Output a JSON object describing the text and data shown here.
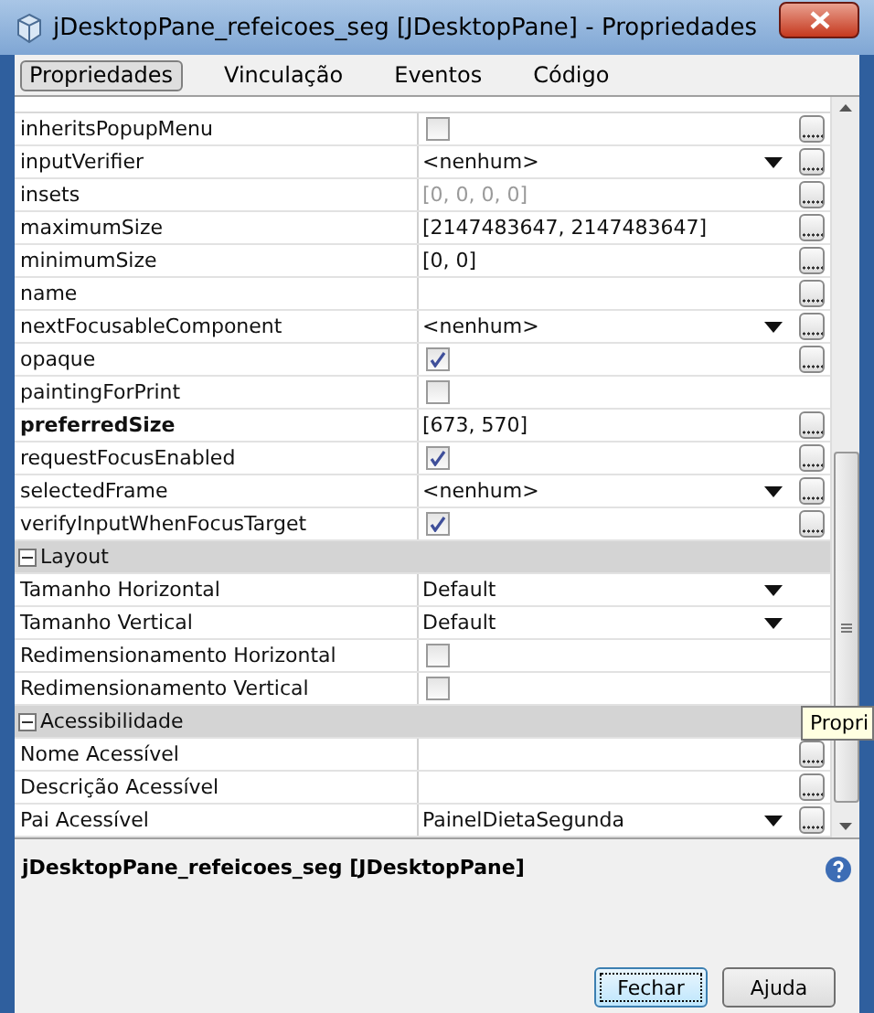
{
  "window": {
    "title": "jDesktopPane_refeicoes_seg [JDesktopPane] - Propriedades"
  },
  "tabs": [
    {
      "label": "Propriedades",
      "selected": true
    },
    {
      "label": "Vinculação",
      "selected": false
    },
    {
      "label": "Eventos",
      "selected": false
    },
    {
      "label": "Código",
      "selected": false
    }
  ],
  "sections": [
    {
      "rows": [
        {
          "name": "inheritsPopupMenu",
          "kind": "checkbox",
          "checked": false,
          "button": true
        },
        {
          "name": "inputVerifier",
          "kind": "dropdown",
          "value": "<nenhum>",
          "button": true
        },
        {
          "name": "insets",
          "kind": "text",
          "value": "[0, 0, 0, 0]",
          "disabled": true,
          "button": true
        },
        {
          "name": "maximumSize",
          "kind": "text",
          "value": "[2147483647, 2147483647]",
          "button": true
        },
        {
          "name": "minimumSize",
          "kind": "text",
          "value": "[0, 0]",
          "button": true
        },
        {
          "name": "name",
          "kind": "text",
          "button": true
        },
        {
          "name": "nextFocusableComponent",
          "kind": "dropdown",
          "value": "<nenhum>",
          "button": true
        },
        {
          "name": "opaque",
          "kind": "checkbox",
          "checked": true,
          "button": true
        },
        {
          "name": "paintingForPrint",
          "kind": "checkbox",
          "checked": false,
          "button": false
        },
        {
          "name": "preferredSize",
          "kind": "text",
          "value": "[673, 570]",
          "modified": true,
          "button": true
        },
        {
          "name": "requestFocusEnabled",
          "kind": "checkbox",
          "checked": true,
          "button": true
        },
        {
          "name": "selectedFrame",
          "kind": "dropdown",
          "value": "<nenhum>",
          "button": true
        },
        {
          "name": "verifyInputWhenFocusTarget",
          "kind": "checkbox",
          "checked": true,
          "button": true
        }
      ]
    },
    {
      "title": "Layout",
      "expanded": true,
      "rows": [
        {
          "name": "Tamanho Horizontal",
          "kind": "dropdown",
          "value": "Default",
          "button": false
        },
        {
          "name": "Tamanho Vertical",
          "kind": "dropdown",
          "value": "Default",
          "button": false
        },
        {
          "name": "Redimensionamento Horizontal",
          "kind": "checkbox",
          "checked": false,
          "button": false
        },
        {
          "name": "Redimensionamento Vertical",
          "kind": "checkbox",
          "checked": false,
          "button": false
        }
      ]
    },
    {
      "title": "Acessibilidade",
      "expanded": true,
      "rows": [
        {
          "name": "Nome Acessível",
          "kind": "text",
          "button": true
        },
        {
          "name": "Descrição Acessível",
          "kind": "text",
          "button": true
        },
        {
          "name": "Pai Acessível",
          "kind": "dropdown",
          "value": "PainelDietaSegunda",
          "button": true
        }
      ]
    }
  ],
  "tooltip": "Propri",
  "description": "jDesktopPane_refeicoes_seg [JDesktopPane]",
  "buttons": [
    {
      "label": "Fechar",
      "focused": true
    },
    {
      "label": "Ajuda",
      "focused": false
    }
  ]
}
